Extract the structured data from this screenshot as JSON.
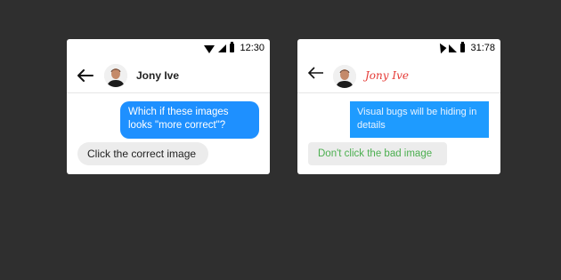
{
  "left_phone": {
    "status_bar": {
      "time": "12:30",
      "icons": [
        "wifi-icon",
        "signal-icon",
        "battery-icon"
      ]
    },
    "header": {
      "contact_name": "Jony Ive"
    },
    "messages": [
      {
        "direction": "outgoing",
        "text": "Which if these images looks \"more correct\"?"
      },
      {
        "direction": "incoming",
        "text": "Click the correct image"
      }
    ],
    "colors": {
      "bubble_out": "#1e90ff",
      "bubble_in": "#ececec",
      "name": "#222222",
      "bubble_in_text": "#222222"
    }
  },
  "right_phone": {
    "status_bar": {
      "time": "31:78",
      "icons": [
        "wifi-icon",
        "signal-icon",
        "battery-icon"
      ]
    },
    "header": {
      "contact_name": "Jony Ive"
    },
    "messages": [
      {
        "direction": "outgoing",
        "text": "Visual bugs will be hiding in details"
      },
      {
        "direction": "incoming",
        "text": "Don't click the bad image"
      }
    ],
    "colors": {
      "bubble_out": "#1e9bff",
      "bubble_in": "#ececec",
      "name": "#e53935",
      "bubble_in_text": "#4caf50"
    }
  }
}
